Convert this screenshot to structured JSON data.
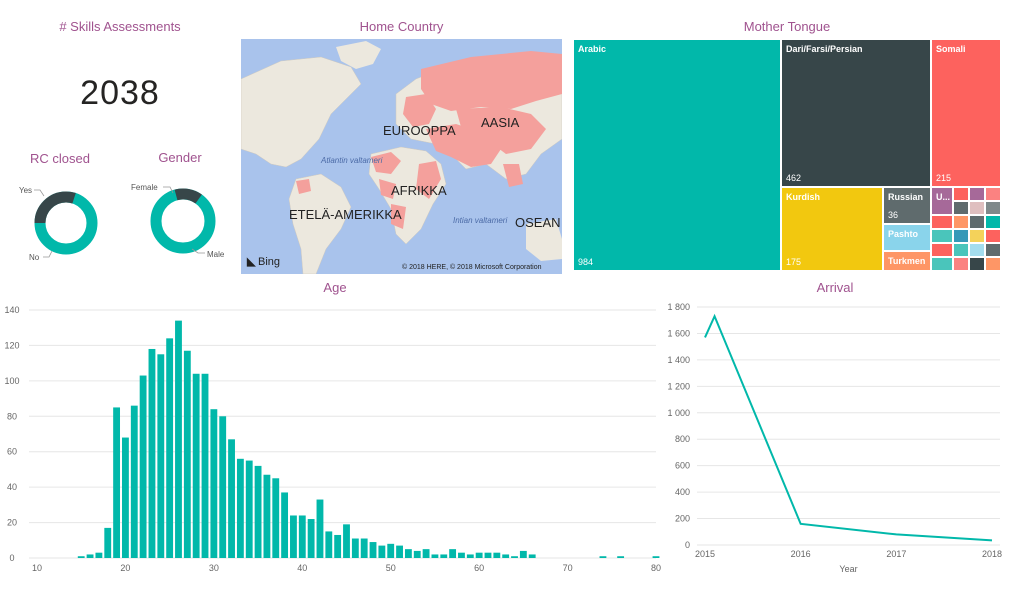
{
  "kpi": {
    "title": "# Skills Assessments",
    "value": "2038"
  },
  "rc": {
    "title": "RC closed",
    "labels": [
      "Yes",
      "No"
    ],
    "fraction_yes": 0.3
  },
  "gender": {
    "title": "Gender",
    "labels": [
      "Female",
      "Male"
    ],
    "fraction_female": 0.14
  },
  "map": {
    "title": "Home Country",
    "regions": [
      "EUROOPPA",
      "AASIA",
      "AFRIKKA",
      "ETELÄ-AMERIKKA",
      "OSEAN"
    ],
    "oceans": [
      "Atlantin valtameri",
      "Intian valtameri"
    ],
    "logo": "Bing",
    "copyright": "© 2018 HERE, © 2018 Microsoft Corporation"
  },
  "treemap": {
    "title": "Mother Tongue",
    "cells": [
      {
        "name": "Arabic",
        "value": "984",
        "color": "#01b8aa"
      },
      {
        "name": "Dari/Farsi/Persian",
        "value": "462",
        "color": "#374649"
      },
      {
        "name": "Somali",
        "value": "215",
        "color": "#fd625e"
      },
      {
        "name": "Kurdish",
        "value": "175",
        "color": "#f2c80f"
      },
      {
        "name": "Russian",
        "value": "36",
        "color": "#5f6b6d"
      },
      {
        "name": "Pashto",
        "value": "",
        "color": "#8ad4eb"
      },
      {
        "name": "Turkmen",
        "value": "",
        "color": "#fe9666"
      },
      {
        "name": "U...",
        "value": "",
        "color": "#a66999"
      }
    ],
    "colors": [
      "#01b8aa",
      "#374649",
      "#fd625e",
      "#f2c80f",
      "#5f6b6d",
      "#8ad4eb",
      "#fe9666",
      "#a66999",
      "#3599b8",
      "#dfbfbf",
      "#4ac5bb",
      "#5f6b6d",
      "#fb8281",
      "#f4d25a",
      "#7f898a",
      "#a4ddee"
    ]
  },
  "chart_data": [
    {
      "type": "bar",
      "title": "Age",
      "xlabel": "",
      "ylabel": "",
      "xlim": [
        10,
        80
      ],
      "ylim": [
        0,
        140
      ],
      "xticks": [
        "10",
        "20",
        "30",
        "40",
        "50",
        "60",
        "70",
        "80"
      ],
      "yticks": [
        "0",
        "20",
        "40",
        "60",
        "80",
        "100",
        "120",
        "140"
      ],
      "x": [
        15,
        16,
        17,
        18,
        19,
        20,
        21,
        22,
        23,
        24,
        25,
        26,
        27,
        28,
        29,
        30,
        31,
        32,
        33,
        34,
        35,
        36,
        37,
        38,
        39,
        40,
        41,
        42,
        43,
        44,
        45,
        46,
        47,
        48,
        49,
        50,
        51,
        52,
        53,
        54,
        55,
        56,
        57,
        58,
        59,
        60,
        61,
        62,
        63,
        64,
        65,
        66,
        74,
        76,
        80
      ],
      "values": [
        1,
        2,
        3,
        17,
        85,
        68,
        86,
        103,
        118,
        115,
        124,
        134,
        117,
        104,
        104,
        84,
        80,
        67,
        56,
        55,
        52,
        47,
        45,
        37,
        24,
        24,
        22,
        33,
        15,
        13,
        19,
        11,
        11,
        9,
        7,
        8,
        7,
        5,
        4,
        5,
        2,
        2,
        5,
        3,
        2,
        3,
        3,
        3,
        2,
        1,
        4,
        2,
        1,
        1,
        1
      ]
    },
    {
      "type": "line",
      "title": "Arrival",
      "xlabel": "Year",
      "ylabel": "",
      "ylim": [
        0,
        1800
      ],
      "yticks": [
        "0",
        "200",
        "400",
        "600",
        "800",
        "1 000",
        "1 200",
        "1 400",
        "1 600",
        "1 800"
      ],
      "x": [
        2015,
        2015.1,
        2016,
        2017,
        2018
      ],
      "xticks": [
        "2015",
        "2016",
        "2017",
        "2018"
      ],
      "values": [
        1570,
        1730,
        160,
        80,
        35
      ]
    }
  ]
}
